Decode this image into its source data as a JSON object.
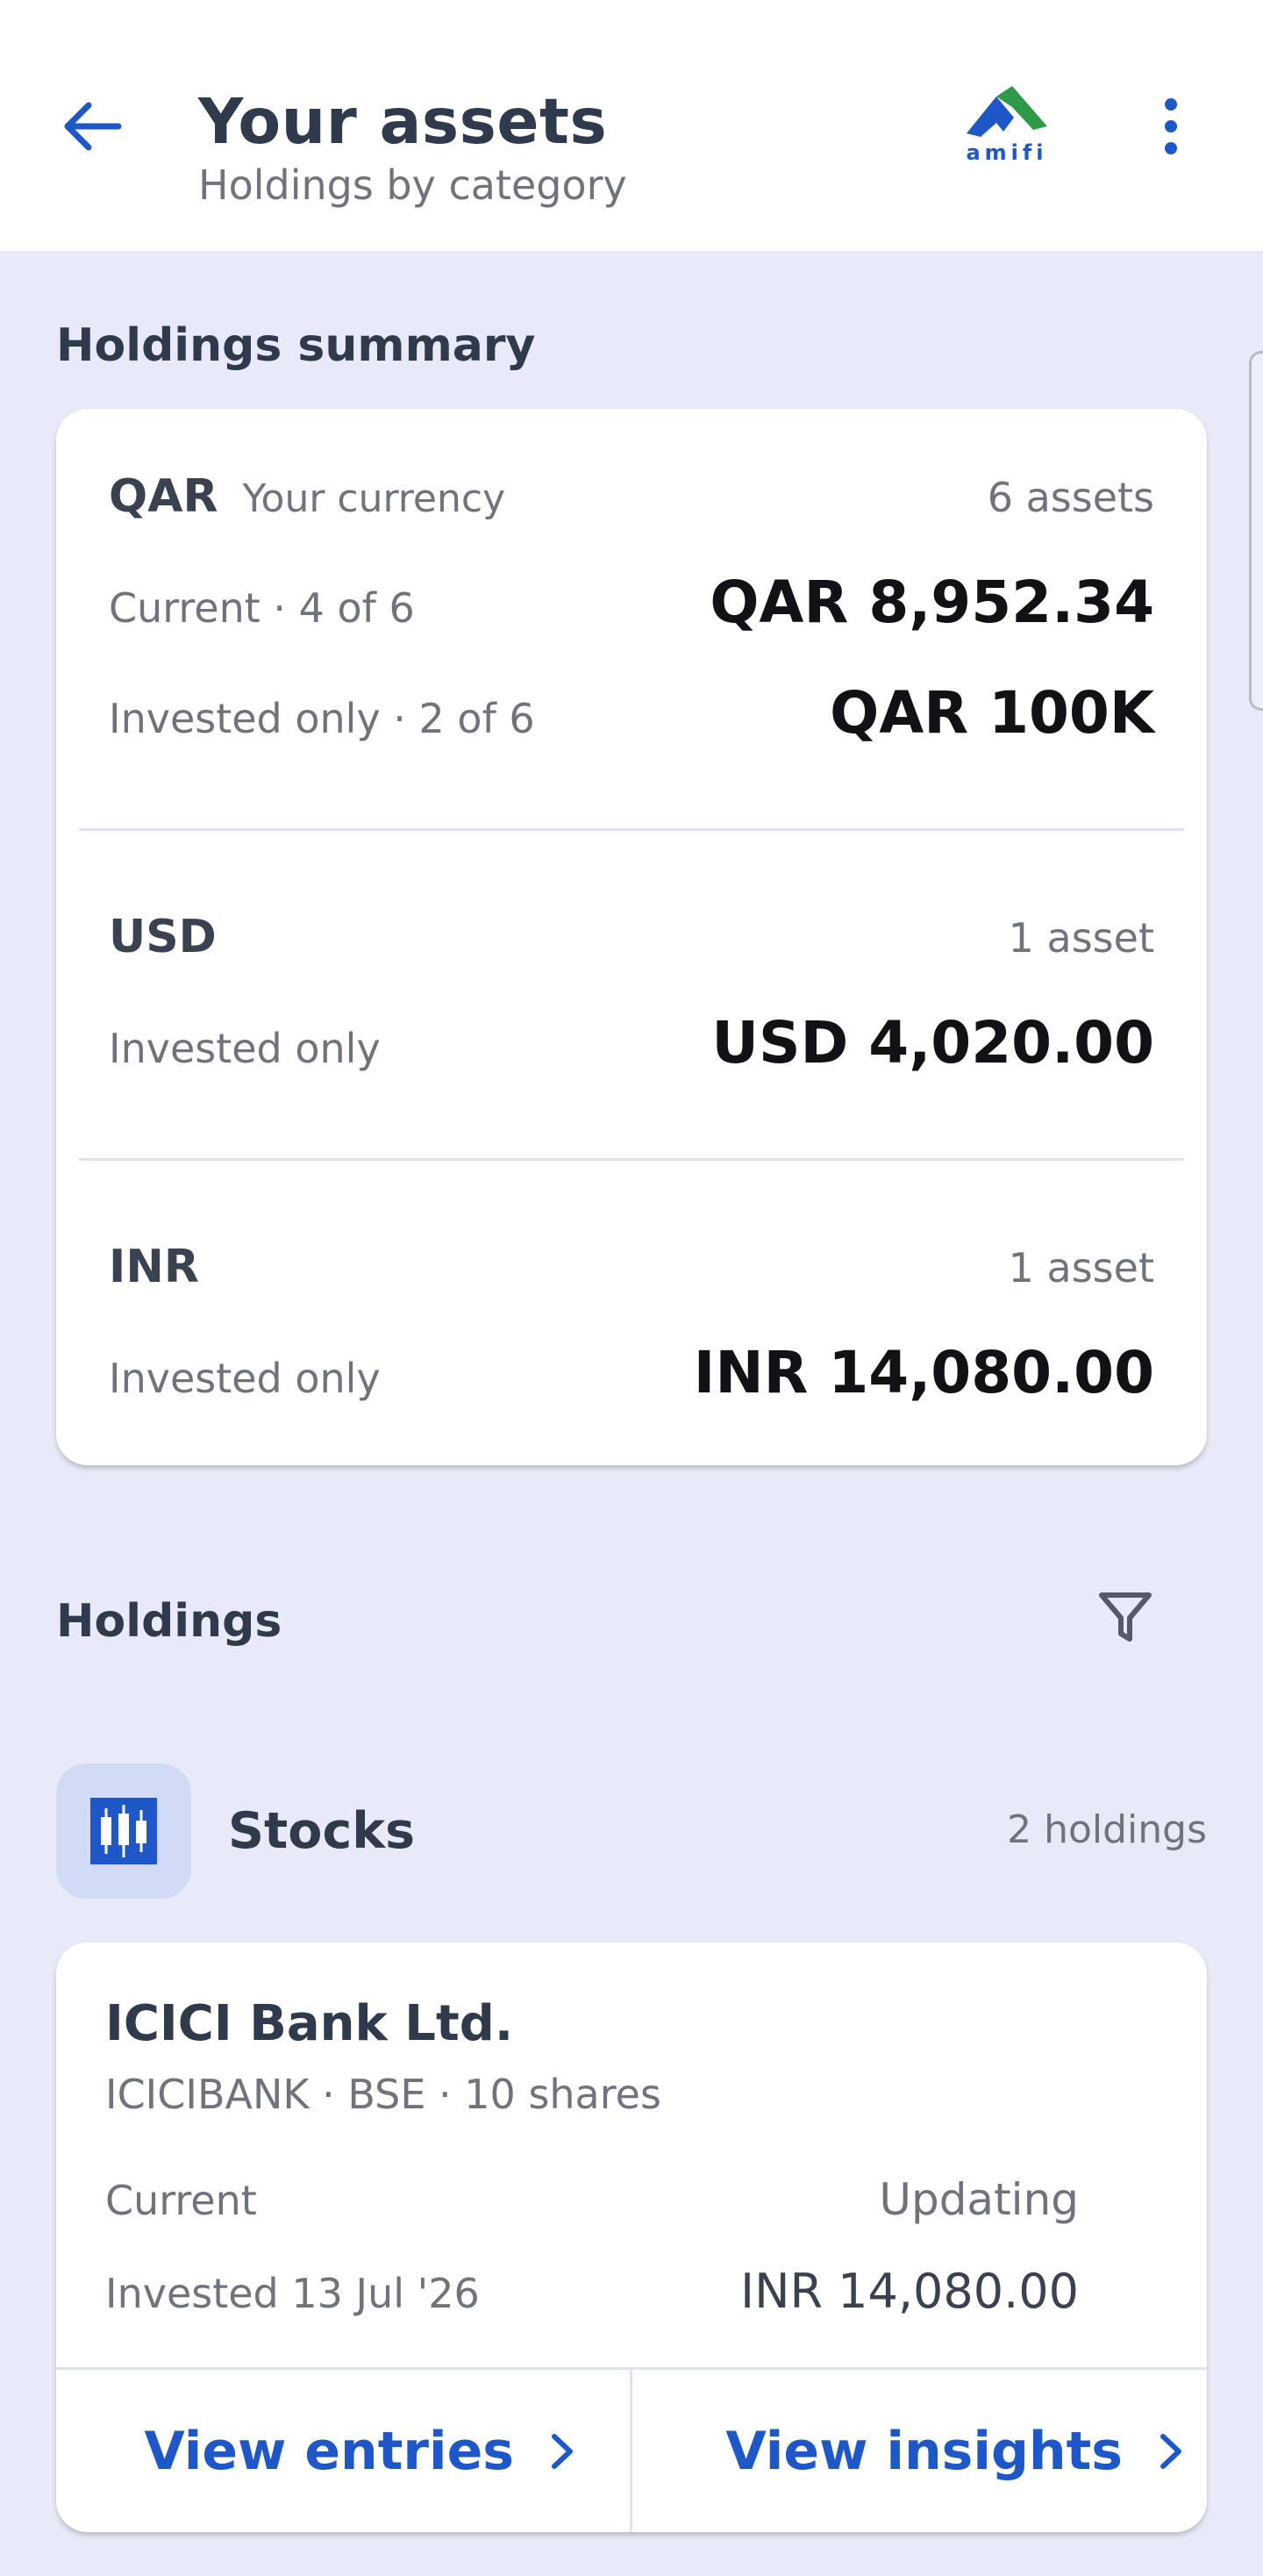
{
  "header": {
    "title": "Your assets",
    "subtitle": "Holdings by category",
    "logo_text": "amifi",
    "brand_colors": {
      "primary": "#1e57c8",
      "green": "#2e9a47"
    }
  },
  "summary": {
    "heading": "Holdings summary",
    "groups": [
      {
        "currency": "QAR",
        "tag": "Your currency",
        "count": "6 assets",
        "rows": [
          {
            "label": "Current · 4 of 6",
            "value": "QAR 8,952.34"
          },
          {
            "label": "Invested only · 2 of 6",
            "value": "QAR 100K"
          }
        ]
      },
      {
        "currency": "USD",
        "count": "1 asset",
        "rows": [
          {
            "label": "Invested only",
            "value": "USD 4,020.00"
          }
        ]
      },
      {
        "currency": "INR",
        "count": "1 asset",
        "rows": [
          {
            "label": "Invested only",
            "value": "INR 14,080.00"
          }
        ]
      }
    ]
  },
  "holdings": {
    "heading": "Holdings",
    "filter_icon": "filter-icon",
    "category": {
      "label": "Stocks",
      "count": "2 holdings",
      "icon": "candlestick-icon"
    },
    "items": [
      {
        "name": "ICICI Bank Ltd.",
        "meta": "ICICIBANK · BSE · 10 shares",
        "current_label": "Current",
        "current_value": "Updating",
        "invested_label": "Invested 13 Jul '26",
        "invested_value": "INR 14,080.00",
        "action_entries": "View entries",
        "action_insights": "View insights"
      }
    ]
  }
}
